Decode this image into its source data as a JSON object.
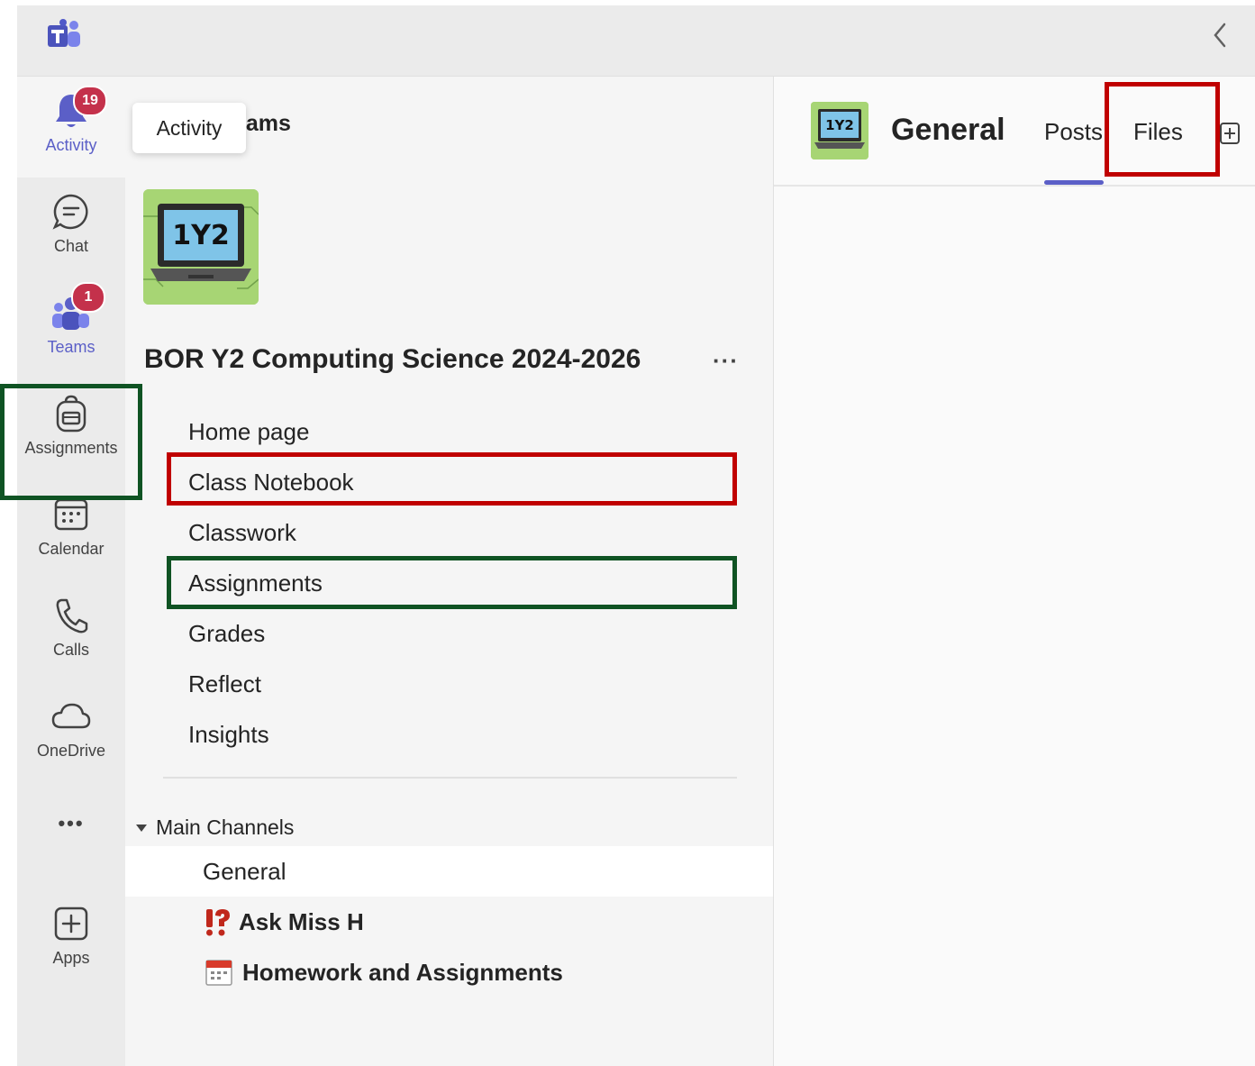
{
  "rail": {
    "items": [
      {
        "label": "Activity",
        "badge": "19",
        "icon": "bell-icon"
      },
      {
        "label": "Chat",
        "icon": "chat-icon"
      },
      {
        "label": "Teams",
        "badge": "1",
        "icon": "teams-icon"
      },
      {
        "label": "Assignments",
        "icon": "backpack-icon"
      },
      {
        "label": "Calendar",
        "icon": "calendar-icon"
      },
      {
        "label": "Calls",
        "icon": "phone-icon"
      },
      {
        "label": "OneDrive",
        "icon": "cloud-icon"
      },
      {
        "label": "Apps",
        "icon": "add-app-icon"
      }
    ],
    "more": "•••"
  },
  "tooltip": "Activity",
  "teams_pane": {
    "title": "Teams",
    "title_visible": "eams",
    "team_logo_text": "1Y2",
    "team_name": "BOR Y2 Computing Science 2024-2026",
    "more": "···",
    "tabs": [
      "Home page",
      "Class Notebook",
      "Classwork",
      "Assignments",
      "Grades",
      "Reflect",
      "Insights"
    ],
    "channels_header": "Main Channels",
    "channels": [
      {
        "label": "General"
      },
      {
        "label": "Ask Miss H",
        "icon": "question-exclamation-icon"
      },
      {
        "label": "Homework and Assignments",
        "icon": "calendar-emoji-icon"
      }
    ]
  },
  "channel_view": {
    "avatar_text": "1Y2",
    "title": "General",
    "tabs": [
      "Posts",
      "Files"
    ],
    "active_tab": "Posts"
  },
  "colors": {
    "accent": "#5b5fc7",
    "badge": "#c4314b",
    "highlight_red": "#c00000",
    "highlight_green": "#0f5323"
  }
}
